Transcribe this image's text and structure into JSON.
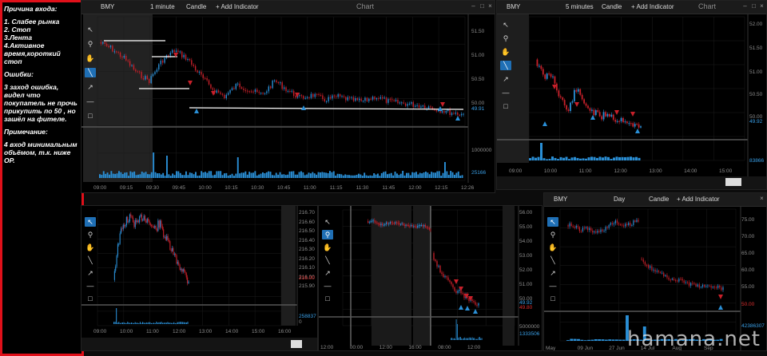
{
  "notes": {
    "entry_reason_title": "Причина входа:",
    "entry_reasons": "1. Слабее рынка\n2. Стоп\n3.Лента\n4.Активное время,короткий стоп",
    "errors_title": "Ошибки:",
    "errors_text": "3 заход ошибка, видел что покупатель не прочь прикупить по 50 , но зашёл на фителе.",
    "remark_title": "Примечание:",
    "remark_text": "4 вход минимальным объёмом, т.к. ниже ОР."
  },
  "panels": {
    "p1": {
      "ticker": "BMY",
      "interval": "1 minute",
      "style": "Candle",
      "add": "+ Add Indicator",
      "title": "Chart",
      "y_labels": [
        "51.50",
        "51.00",
        "50.50",
        "50.00"
      ],
      "price_tag": "49.91",
      "vol_label": "1000000",
      "vol_tag": "25166",
      "x_labels": [
        "09:00",
        "09:15",
        "09:30",
        "09:45",
        "10:00",
        "10:15",
        "10:30",
        "10:45",
        "11:00",
        "11:15",
        "11:30",
        "11:45",
        "12:00",
        "12:15",
        "12:26"
      ]
    },
    "p2": {
      "ticker": "BMY",
      "interval": "5 minutes",
      "style": "Candle",
      "add": "+ Add Indicator",
      "title": "Chart",
      "y_labels": [
        "52.00",
        "51.50",
        "51.00",
        "50.50",
        "50.00"
      ],
      "price_tag": "49.92",
      "vol_tag": "83866",
      "x_labels": [
        "09:00",
        "10:00",
        "11:00",
        "12:00",
        "13:00",
        "14:00",
        "15:00"
      ]
    },
    "p3": {
      "y_labels": [
        "216.70",
        "216.60",
        "216.50",
        "216.40",
        "216.30",
        "216.20",
        "216.10",
        "216.00",
        "215.90"
      ],
      "price_tag": "216.00",
      "vol_tag": "258837",
      "vol_zero": "0",
      "x_labels": [
        "09:00",
        "10:00",
        "11:00",
        "12:00",
        "13:00",
        "14:00",
        "15:00",
        "16:00"
      ]
    },
    "p4": {
      "y_labels": [
        "56.00",
        "55.00",
        "54.00",
        "53.00",
        "52.00",
        "51.00",
        "50.00"
      ],
      "price_tag": "49.92",
      "price_tag2": "49.80",
      "vol_label": "5000000",
      "vol_tag": "1333506",
      "x_labels": [
        "12:00",
        "00:00",
        "12:00",
        "16:00",
        "08:00",
        "12:00"
      ]
    },
    "p5": {
      "ticker": "BMY",
      "interval": "Day",
      "style": "Candle",
      "add": "+ Add Indicator",
      "y_labels": [
        "75.00",
        "70.00",
        "65.00",
        "60.00",
        "55.00"
      ],
      "price_tag": "50.00",
      "vol_tag": "42386307",
      "x_labels": [
        "May",
        "09 Jun",
        "27 Jun",
        "14 Jul",
        "Aug",
        "Sep"
      ]
    }
  },
  "tools": [
    "pointer-icon",
    "zoom-icon",
    "hand-icon",
    "line-icon",
    "arrow-icon",
    "hline-icon",
    "rect-icon"
  ],
  "colors": {
    "up": "#2a8fd6",
    "down": "#c8202a",
    "volume": "#2a8fd6",
    "accent": "#1f6fb5",
    "notes_border": "#e0101a"
  },
  "watermark": "hamana.net"
}
